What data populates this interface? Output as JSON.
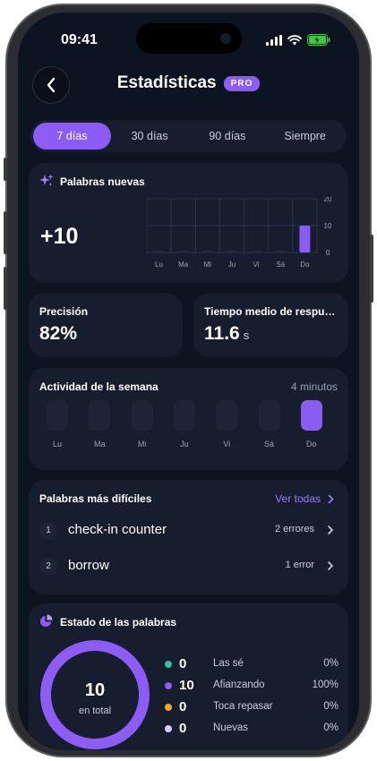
{
  "status": {
    "time": "09:41"
  },
  "header": {
    "title": "Estadísticas",
    "badge": "PRO"
  },
  "range_tabs": [
    {
      "label": "7 días",
      "active": true
    },
    {
      "label": "30 días",
      "active": false
    },
    {
      "label": "90 días",
      "active": false
    },
    {
      "label": "Siempre",
      "active": false
    }
  ],
  "new_words": {
    "title": "Palabras nuevas",
    "value": "+10",
    "chart_data": {
      "type": "bar",
      "categories": [
        "Lu",
        "Ma",
        "Mi",
        "Ju",
        "Vi",
        "Sá",
        "Do"
      ],
      "values": [
        0,
        0,
        0,
        0,
        0,
        0,
        10
      ],
      "y_ticks": [
        "20",
        "10",
        "0"
      ],
      "ylim": [
        0,
        20
      ],
      "grid": true
    }
  },
  "precision": {
    "label": "Precisión",
    "value": "82%"
  },
  "avg_time": {
    "label": "Tiempo medio de respue…",
    "value": "11.6",
    "unit": "s"
  },
  "activity": {
    "title": "Actividad de la semana",
    "total": "4 minutos",
    "days": [
      {
        "label": "Lu",
        "active": false
      },
      {
        "label": "Ma",
        "active": false
      },
      {
        "label": "Mi",
        "active": false
      },
      {
        "label": "Ju",
        "active": false
      },
      {
        "label": "Vi",
        "active": false
      },
      {
        "label": "Sá",
        "active": false
      },
      {
        "label": "Do",
        "active": true
      }
    ]
  },
  "difficult": {
    "title": "Palabras más difíciles",
    "see_all": "Ver todas",
    "items": [
      {
        "num": "1",
        "word": "check-in counter",
        "errors": "2 errores"
      },
      {
        "num": "2",
        "word": "borrow",
        "errors": "1 error"
      }
    ]
  },
  "state": {
    "title": "Estado de las palabras",
    "total_num": "10",
    "total_label": "en total",
    "items": [
      {
        "count": "0",
        "name": "Las sé",
        "pct": "0%",
        "color": "#2ec4a6"
      },
      {
        "count": "10",
        "name": "Afianzando",
        "pct": "100%",
        "color": "#8d5cf6"
      },
      {
        "count": "0",
        "name": "Toca repasar",
        "pct": "0%",
        "color": "#f5a524"
      },
      {
        "count": "0",
        "name": "Nuevas",
        "pct": "0%",
        "color": "#d8cff7"
      }
    ]
  },
  "colors": {
    "accent": "#8d5cf6",
    "background": "#0d1421",
    "card": "#161e2d"
  }
}
